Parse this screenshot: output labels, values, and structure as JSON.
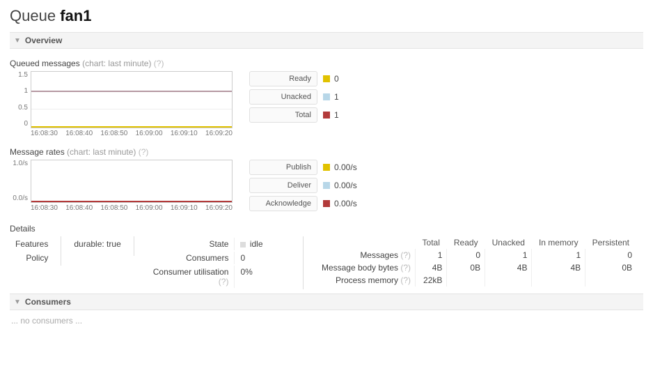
{
  "title": {
    "prefix": "Queue",
    "name": "fan1"
  },
  "sections": {
    "overview": "Overview",
    "consumers": "Consumers"
  },
  "queued": {
    "heading": "Queued messages",
    "sub": "(chart: last minute)",
    "help": "(?)",
    "legend": [
      {
        "label": "Ready",
        "color": "#e1c200",
        "value": "0"
      },
      {
        "label": "Unacked",
        "color": "#b8d7e8",
        "value": "1"
      },
      {
        "label": "Total",
        "color": "#b23a3a",
        "value": "1"
      }
    ]
  },
  "rates": {
    "heading": "Message rates",
    "sub": "(chart: last minute)",
    "help": "(?)",
    "legend": [
      {
        "label": "Publish",
        "color": "#e1c200",
        "value": "0.00/s"
      },
      {
        "label": "Deliver",
        "color": "#b8d7e8",
        "value": "0.00/s"
      },
      {
        "label": "Acknowledge",
        "color": "#b23a3a",
        "value": "0.00/s"
      }
    ]
  },
  "details": {
    "heading": "Details",
    "features_label": "Features",
    "features_value": "durable: true",
    "policy_label": "Policy",
    "policy_value": "",
    "state_label": "State",
    "state_value": "idle",
    "consumers_label": "Consumers",
    "consumers_value": "0",
    "util_label": "Consumer utilisation",
    "util_help": "(?)",
    "util_value": "0%",
    "stats": {
      "cols": [
        "Total",
        "Ready",
        "Unacked",
        "In memory",
        "Persistent"
      ],
      "rows": [
        {
          "label": "Messages",
          "help": "(?)",
          "vals": [
            "1",
            "0",
            "1",
            "1",
            "0"
          ]
        },
        {
          "label": "Message body bytes",
          "help": "(?)",
          "vals": [
            "4B",
            "0B",
            "4B",
            "4B",
            "0B"
          ]
        },
        {
          "label": "Process memory",
          "help": "(?)",
          "vals": [
            "22kB",
            "",
            "",
            "",
            ""
          ]
        }
      ]
    }
  },
  "consumers_empty": "... no consumers ...",
  "chart_data": [
    {
      "type": "line",
      "title": "Queued messages (last minute)",
      "x": [
        "16:08:30",
        "16:08:40",
        "16:08:50",
        "16:09:00",
        "16:09:10",
        "16:09:20"
      ],
      "series": [
        {
          "name": "Ready",
          "color": "#e1c200",
          "values": [
            0,
            0,
            0,
            0,
            0,
            0
          ]
        },
        {
          "name": "Unacked",
          "color": "#b8d7e8",
          "values": [
            1,
            1,
            1,
            1,
            1,
            1
          ]
        },
        {
          "name": "Total",
          "color": "#b23a3a",
          "values": [
            1,
            1,
            1,
            1,
            1,
            1
          ]
        }
      ],
      "yticks": [
        0.0,
        0.5,
        1.0,
        1.5
      ],
      "ylim": [
        0,
        1.5
      ],
      "xlabel": "",
      "ylabel": ""
    },
    {
      "type": "line",
      "title": "Message rates (last minute)",
      "x": [
        "16:08:30",
        "16:08:40",
        "16:08:50",
        "16:09:00",
        "16:09:10",
        "16:09:20"
      ],
      "series": [
        {
          "name": "Publish",
          "color": "#e1c200",
          "values": [
            0,
            0,
            0,
            0,
            0,
            0
          ]
        },
        {
          "name": "Deliver",
          "color": "#b8d7e8",
          "values": [
            0,
            0,
            0,
            0,
            0,
            0
          ]
        },
        {
          "name": "Acknowledge",
          "color": "#b23a3a",
          "values": [
            0,
            0,
            0,
            0,
            0,
            0
          ]
        }
      ],
      "yticks": [
        "0.0/s",
        "1.0/s"
      ],
      "ylim": [
        0,
        1
      ],
      "xlabel": "",
      "ylabel": ""
    }
  ]
}
